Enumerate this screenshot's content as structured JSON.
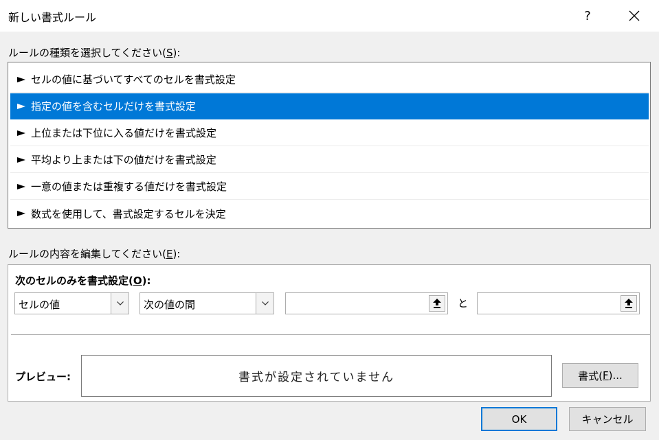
{
  "window": {
    "title": "新しい書式ルール",
    "help_label": "?"
  },
  "rule_type": {
    "label_prefix": "ルールの種類を選択してください(",
    "label_accel": "S",
    "label_suffix": "):",
    "items": [
      {
        "label": "セルの値に基づいてすべてのセルを書式設定",
        "selected": false
      },
      {
        "label": "指定の値を含むセルだけを書式設定",
        "selected": true
      },
      {
        "label": "上位または下位に入る値だけを書式設定",
        "selected": false
      },
      {
        "label": "平均より上または下の値だけを書式設定",
        "selected": false
      },
      {
        "label": "一意の値または重複する値だけを書式設定",
        "selected": false
      },
      {
        "label": "数式を使用して、書式設定するセルを決定",
        "selected": false
      }
    ]
  },
  "rule_edit": {
    "label_prefix": "ルールの内容を編集してください(",
    "label_accel": "E",
    "label_suffix": "):",
    "heading_prefix": "次のセルのみを書式設定(",
    "heading_accel": "O",
    "heading_suffix": "):",
    "combo1_value": "セルの値",
    "combo2_value": "次の値の間",
    "value1": "",
    "value2": "",
    "and_label": "と",
    "preview_label": "プレビュー:",
    "preview_text": "書式が設定されていません",
    "format_button_prefix": "書式(",
    "format_button_accel": "F",
    "format_button_suffix": ")..."
  },
  "footer": {
    "ok_label": "OK",
    "cancel_label": "キャンセル"
  },
  "colors": {
    "selection": "#0078d7",
    "dialog_bg": "#f0f0f0"
  },
  "icons": {
    "close": "close-icon",
    "list_arrow": "play-arrow-icon",
    "dropdown": "chevron-down-icon",
    "range_select": "upload-arrow-icon"
  }
}
